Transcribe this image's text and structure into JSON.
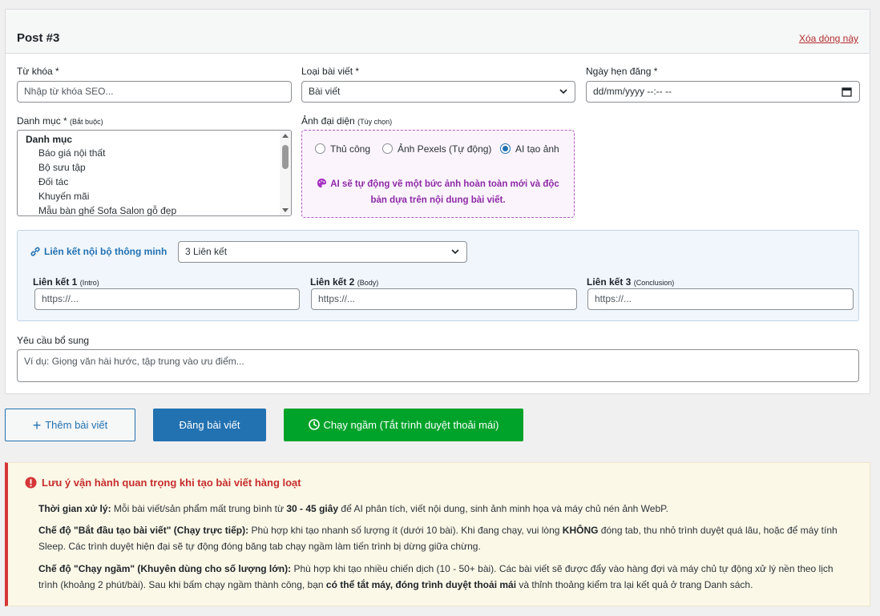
{
  "post": {
    "title": "Post #3",
    "delete_link": "Xóa dòng này"
  },
  "keyword": {
    "label": "Từ khóa *",
    "placeholder": "Nhập từ khóa SEO..."
  },
  "post_type": {
    "label": "Loại bài viết *",
    "selected": "Bài viết"
  },
  "schedule": {
    "label": "Ngày hẹn đăng *",
    "placeholder": "dd/mm/yyyy --:-- --"
  },
  "category": {
    "label": "Danh mục *",
    "label_note": "(Bắt buộc)",
    "group": "Danh mục",
    "options": [
      "Báo giá nội thất",
      "Bộ sưu tập",
      "Đối tác",
      "Khuyến mãi",
      "Mẫu bàn ghế Sofa Salon gỗ đẹp"
    ]
  },
  "thumbnail": {
    "label": "Ảnh đại diện",
    "label_note": "(Tùy chọn)",
    "options": [
      "Thủ công",
      "Ảnh Pexels (Tự động)",
      "AI tạo ảnh"
    ],
    "selected_index": 2,
    "ai_note_line1": "AI sẽ tự động vẽ một bức ảnh hoàn toàn mới và độc",
    "ai_note_line2": "bản dựa trên nội dung bài viết."
  },
  "internal_links": {
    "label": "Liên kết nội bộ thông minh",
    "selected": "3 Liên kết",
    "link1_label": "Liên kết 1",
    "link1_note": "(Intro)",
    "link2_label": "Liên kết 2",
    "link2_note": "(Body)",
    "link3_label": "Liên kết 3",
    "link3_note": "(Conclusion)",
    "placeholder": "https://..."
  },
  "extra": {
    "label": "Yêu cầu bổ sung",
    "placeholder": "Ví dụ: Giọng văn hài hước, tập trung vào ưu điểm..."
  },
  "buttons": {
    "add": "Thêm bài viết",
    "publish": "Đăng bài viết",
    "background": "Chạy ngầm (Tắt trình duyệt thoải mái)"
  },
  "notice": {
    "title": "Lưu ý vận hành quan trọng khi tạo bài viết hàng loạt",
    "p1_b1": "Thời gian xử lý:",
    "p1_t1": " Mỗi bài viết/sản phẩm mất trung bình từ ",
    "p1_b2": "30 - 45 giây",
    "p1_t2": " để AI phân tích, viết nội dung, sinh ảnh minh họa và máy chủ nén ảnh WebP.",
    "p2_b1": "Chế độ \"Bắt đầu tạo bài viết\" (Chạy trực tiếp):",
    "p2_t1": " Phù hợp khi tạo nhanh số lượng ít (dưới 10 bài). Khi đang chạy, vui lòng ",
    "p2_b2": "KHÔNG",
    "p2_t2": " đóng tab, thu nhỏ trình duyệt quá lâu, hoặc để máy tính Sleep. Các trình duyệt hiện đại sẽ tự động đóng băng tab chạy ngầm làm tiến trình bị dừng giữa chừng.",
    "p3_b1": "Chế độ \"Chạy ngầm\" (Khuyên dùng cho số lượng lớn):",
    "p3_t1": " Phù hợp khi tạo nhiều chiến dịch (10 - 50+ bài). Các bài viết sẽ được đẩy vào hàng đợi và máy chủ tự động xử lý nền theo lịch trình (khoảng 2 phút/bài). Sau khi bấm chạy ngầm thành công, bạn ",
    "p3_b2": "có thể tắt máy, đóng trình duyệt thoải mái",
    "p3_t2": " và thỉnh thoảng kiểm tra lại kết quả ở trang Danh sách."
  },
  "colors": {
    "primary": "#2271b1",
    "success": "#00a32a",
    "danger": "#d63638",
    "ai_purple": "#8e2aa6"
  }
}
